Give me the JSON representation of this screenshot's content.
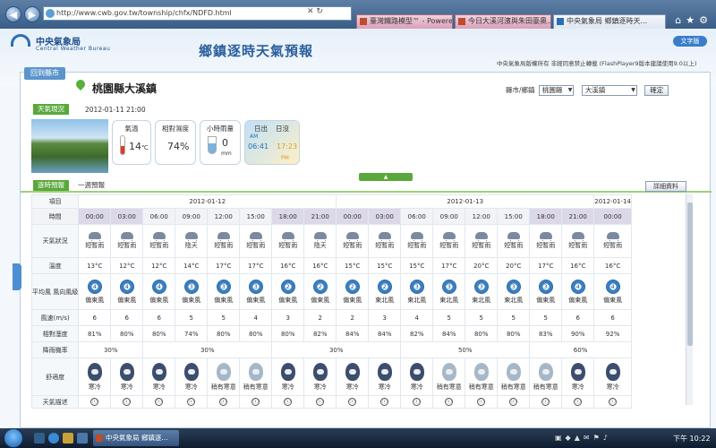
{
  "browser": {
    "url": "http://www.cwb.gov.tw/township/chfx/NDFD.html",
    "tabs": [
      {
        "label": "臺灣鐵路模型™ - Powere...",
        "active": false
      },
      {
        "label": "今日大溪河濱與朱田豪奧...",
        "active": false
      },
      {
        "label": "中央氣象局 鄉鎮逐時天...",
        "active": true
      }
    ]
  },
  "header": {
    "logo_zh": "中央氣象局",
    "logo_en": "Central Weather Bureau",
    "banner": "鄉鎮逐時天氣預報",
    "text_version": "文字版",
    "copyright": "中央氣象局版權所有 非經同意禁止轉載 (FlashPlayer9版本建議使用9.0以上)"
  },
  "location": {
    "back_label": "回到縣市",
    "town": "桃園縣大溪鎮",
    "selector_label": "縣市/鄉鎮",
    "county": "桃園縣",
    "township": "大溪鎮",
    "confirm": "確定"
  },
  "now": {
    "tab": "天氣現況",
    "time": "2012-01-11 21:00",
    "temp_label": "氣溫",
    "temp": "14",
    "temp_unit": "℃",
    "hum_label": "相對濕度",
    "hum": "74%",
    "rain_label": "小時雨量",
    "rain": "0",
    "rain_unit": "mm",
    "sunrise_label": "日出",
    "sunset_label": "日沒",
    "sunrise": "06:41",
    "sunset": "17:23",
    "am": "AM",
    "pm": "PM"
  },
  "forecast": {
    "tab_hourly": "逐時預報",
    "tab_weekly": "一週預報",
    "detail": "詳細資料",
    "toggle": "▲",
    "row_labels": {
      "item": "項目",
      "time": "時間",
      "wx": "天氣狀況",
      "temp": "溫度",
      "wind": "平均風 風向風級",
      "speed": "風速(m/s)",
      "hum": "相對溼度",
      "rain": "降雨機率",
      "comfort": "舒適度",
      "desc": "天氣描述"
    },
    "dates": [
      {
        "label": "2012-01-12",
        "span": 8
      },
      {
        "label": "2012-01-13",
        "span": 8
      },
      {
        "label": "2012-01-14",
        "span": 1
      }
    ],
    "times": [
      "00:00",
      "03:00",
      "06:00",
      "09:00",
      "12:00",
      "15:00",
      "18:00",
      "21:00",
      "00:00",
      "03:00",
      "06:00",
      "09:00",
      "12:00",
      "15:00",
      "18:00",
      "21:00",
      "00:00"
    ],
    "night": [
      true,
      true,
      false,
      false,
      false,
      false,
      true,
      true,
      true,
      true,
      false,
      false,
      false,
      false,
      true,
      true,
      true
    ],
    "wx": [
      "短暫雨",
      "短暫雨",
      "短暫雨",
      "陰天",
      "短暫雨",
      "短暫雨",
      "短暫雨",
      "陰天",
      "短暫雨",
      "短暫雨",
      "短暫雨",
      "短暫雨",
      "短暫雨",
      "短暫雨",
      "短暫雨",
      "短暫雨",
      "短暫雨"
    ],
    "temp": [
      "13°C",
      "12°C",
      "12°C",
      "14°C",
      "17°C",
      "17°C",
      "16°C",
      "16°C",
      "15°C",
      "15°C",
      "15°C",
      "17°C",
      "20°C",
      "20°C",
      "17°C",
      "16°C",
      "16°C"
    ],
    "wind_level": [
      "4",
      "4",
      "4",
      "3",
      "3",
      "3",
      "2",
      "2",
      "2",
      "2",
      "3",
      "3",
      "3",
      "3",
      "3",
      "4",
      "4"
    ],
    "wind_dir": [
      "偏東風",
      "偏東風",
      "偏東風",
      "偏東風",
      "偏東風",
      "偏東風",
      "偏東風",
      "偏東風",
      "偏東風",
      "東北風",
      "東北風",
      "東北風",
      "東北風",
      "東北風",
      "偏東風",
      "偏東風",
      "偏東風"
    ],
    "speed": [
      "6",
      "6",
      "6",
      "5",
      "5",
      "4",
      "3",
      "2",
      "2",
      "3",
      "4",
      "5",
      "5",
      "5",
      "5",
      "6",
      "6"
    ],
    "hum": [
      "81%",
      "80%",
      "80%",
      "74%",
      "80%",
      "80%",
      "80%",
      "82%",
      "84%",
      "84%",
      "82%",
      "84%",
      "80%",
      "80%",
      "83%",
      "90%",
      "92%"
    ],
    "rain": [
      {
        "v": "30%",
        "span": 2
      },
      {
        "v": "30%",
        "span": 4
      },
      {
        "v": "30%",
        "span": 4
      },
      {
        "v": "50%",
        "span": 4
      },
      {
        "v": "60%",
        "span": 3
      }
    ],
    "comfort": [
      "寒冷",
      "寒冷",
      "寒冷",
      "寒冷",
      "稍有寒意",
      "稍有寒意",
      "寒冷",
      "寒冷",
      "寒冷",
      "寒冷",
      "寒冷",
      "稍有寒意",
      "稍有寒意",
      "稍有寒意",
      "稍有寒意",
      "寒冷",
      "寒冷"
    ],
    "comfort_mild": [
      false,
      false,
      false,
      false,
      true,
      true,
      false,
      false,
      false,
      false,
      false,
      true,
      true,
      true,
      true,
      false,
      false
    ],
    "desc_icon": "ⓘ"
  },
  "taskbar": {
    "task": "中央氣象局 鄉鎮逐...",
    "clock": "下午 10:22"
  }
}
